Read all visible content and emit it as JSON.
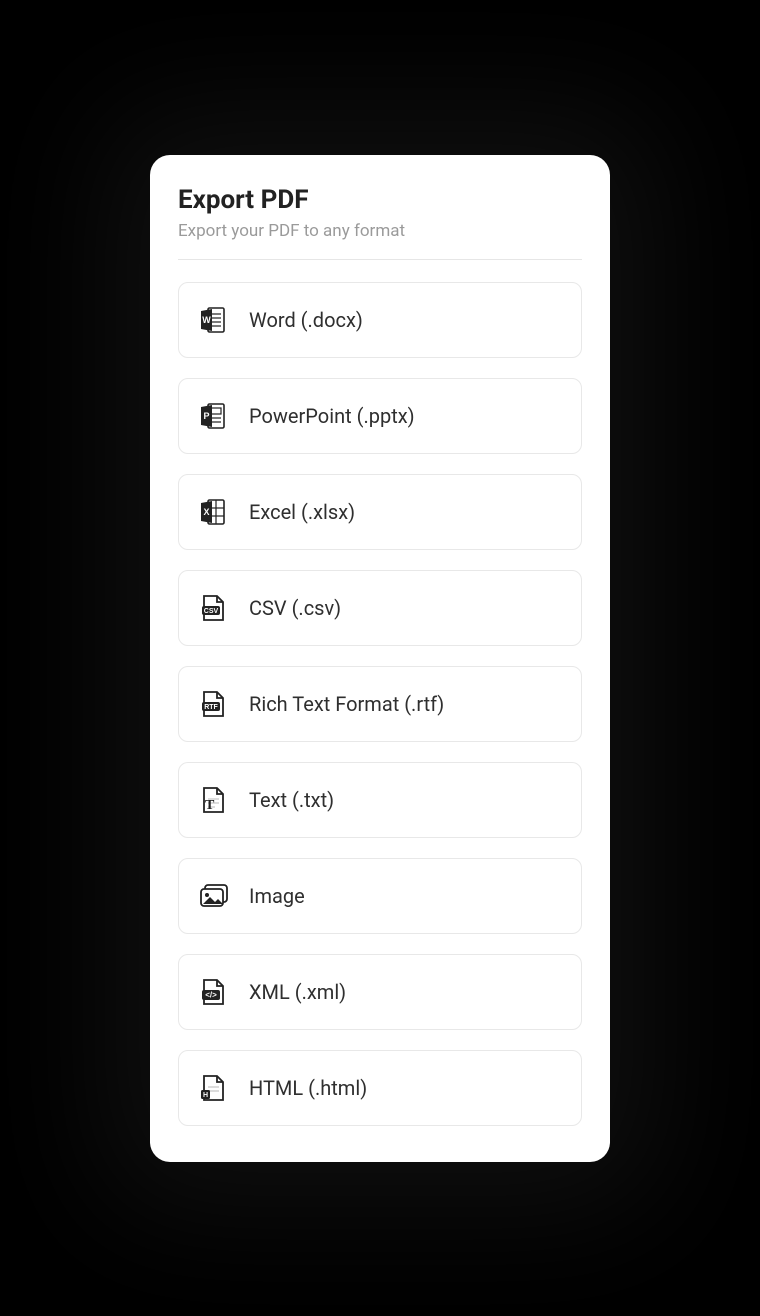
{
  "header": {
    "title": "Export PDF",
    "subtitle": "Export your PDF to any format"
  },
  "options": [
    {
      "id": "word",
      "icon": "word-icon",
      "label": "Word (.docx)"
    },
    {
      "id": "powerpoint",
      "icon": "powerpoint-icon",
      "label": "PowerPoint (.pptx)"
    },
    {
      "id": "excel",
      "icon": "excel-icon",
      "label": "Excel (.xlsx)"
    },
    {
      "id": "csv",
      "icon": "csv-icon",
      "label": "CSV (.csv)"
    },
    {
      "id": "rtf",
      "icon": "rtf-icon",
      "label": "Rich Text Format (.rtf)"
    },
    {
      "id": "txt",
      "icon": "text-icon",
      "label": "Text (.txt)"
    },
    {
      "id": "image",
      "icon": "image-icon",
      "label": "Image"
    },
    {
      "id": "xml",
      "icon": "xml-icon",
      "label": "XML (.xml)"
    },
    {
      "id": "html",
      "icon": "html-icon",
      "label": "HTML (.html)"
    }
  ]
}
